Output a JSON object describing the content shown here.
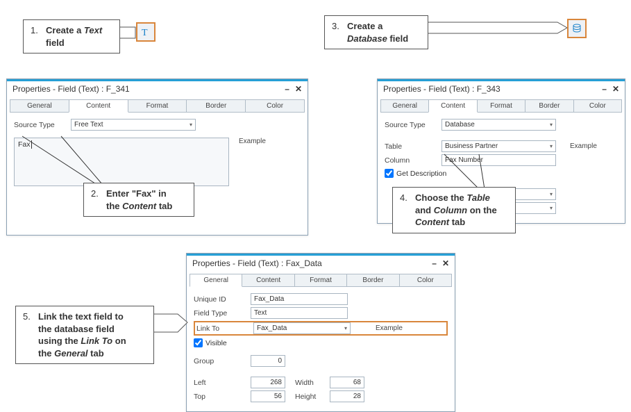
{
  "callouts": {
    "c1_num": "1.",
    "c1_line1a": "Create a ",
    "c1_line1b": "Text",
    "c1_line2": "field",
    "c2_num": "2.",
    "c2_l1": "Enter \"Fax\" in",
    "c2_l2a": "the ",
    "c2_l2b": "Content",
    "c2_l2c": " tab",
    "c3_num": "3.",
    "c3_l1": "Create a",
    "c3_l2a": "Database",
    "c3_l2b": " field",
    "c4_num": "4.",
    "c4_l1a": "Choose the ",
    "c4_l1b": "Table",
    "c4_l2a": "and ",
    "c4_l2b": "Column",
    "c4_l2c": " on the",
    "c4_l3a": "Content",
    "c4_l3b": " tab",
    "c5_num": "5.",
    "c5_l1": "Link the text field to",
    "c5_l2": "the database field",
    "c5_l3a": "using the ",
    "c5_l3b": "Link To",
    "c5_l3c": " on",
    "c5_l4a": "the ",
    "c5_l4b": "General",
    "c5_l4c": " tab"
  },
  "win1": {
    "title": "Properties - Field (Text) : F_341",
    "tabs": {
      "t0": "General",
      "t1": "Content",
      "t2": "Format",
      "t3": "Border",
      "t4": "Color"
    },
    "labels": {
      "sourceType": "Source Type",
      "example": "Example"
    },
    "sourceTypeValue": "Free Text",
    "textValue": "Fax"
  },
  "win2": {
    "title": "Properties - Field (Text) : F_343",
    "tabs": {
      "t0": "General",
      "t1": "Content",
      "t2": "Format",
      "t3": "Border",
      "t4": "Color"
    },
    "labels": {
      "sourceType": "Source Type",
      "table": "Table",
      "column": "Column",
      "getDesc": "Get Description",
      "example": "Example"
    },
    "vals": {
      "sourceType": "Database",
      "table": "Business Partner",
      "column": "Fax Number"
    }
  },
  "win3": {
    "title": "Properties - Field (Text) : Fax_Data",
    "tabs": {
      "t0": "General",
      "t1": "Content",
      "t2": "Format",
      "t3": "Border",
      "t4": "Color"
    },
    "labels": {
      "uniqueId": "Unique ID",
      "fieldType": "Field Type",
      "linkTo": "Link To",
      "visible": "Visible",
      "group": "Group",
      "left": "Left",
      "top": "Top",
      "width": "Width",
      "height": "Height",
      "example": "Example"
    },
    "vals": {
      "uniqueId": "Fax_Data",
      "fieldType": "Text",
      "linkTo": "Fax_Data",
      "group": "0",
      "left": "268",
      "top": "56",
      "width": "68",
      "height": "28"
    }
  },
  "ctrls": {
    "min": "–",
    "close": "✕"
  }
}
